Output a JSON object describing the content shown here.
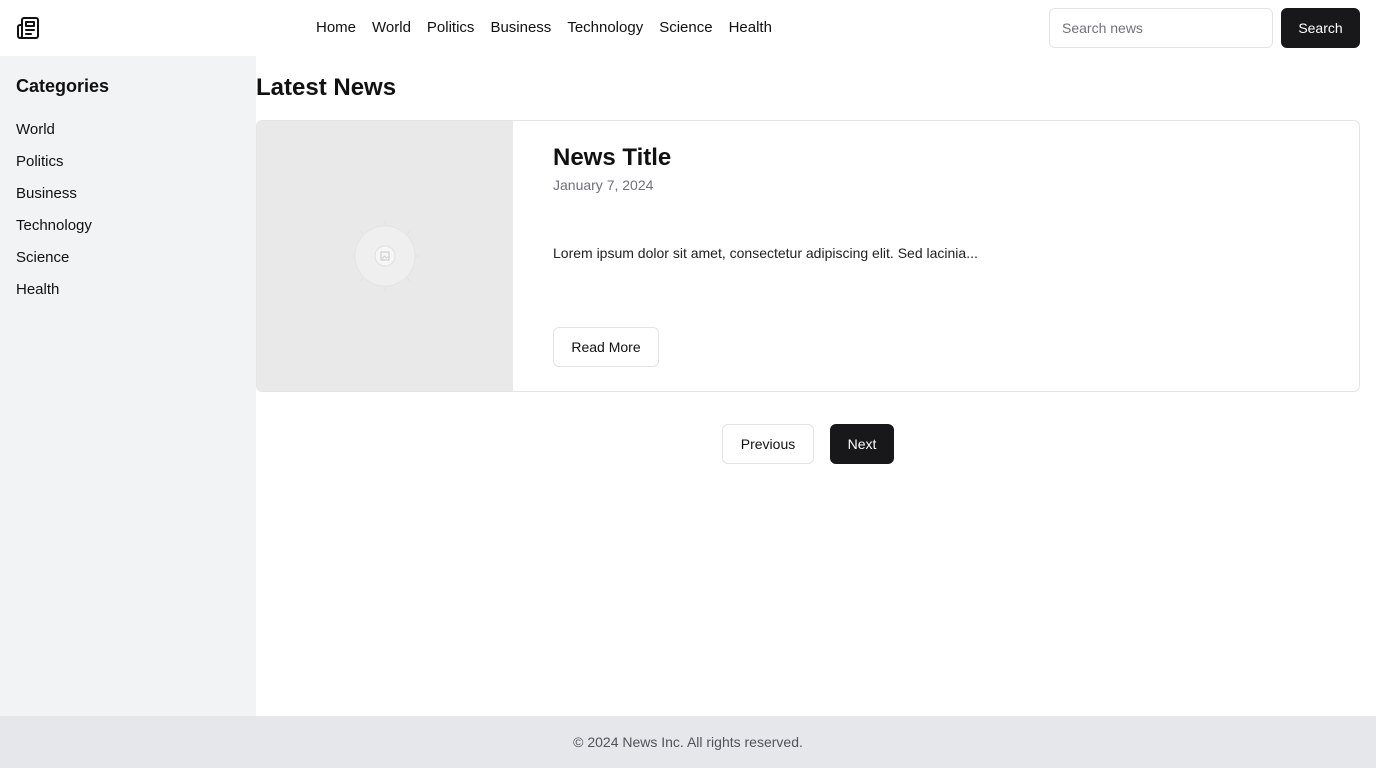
{
  "header": {
    "logo_icon": "newspaper-icon",
    "nav": [
      "Home",
      "World",
      "Politics",
      "Business",
      "Technology",
      "Science",
      "Health"
    ],
    "search": {
      "placeholder": "Search news",
      "value": "",
      "button_label": "Search"
    }
  },
  "sidebar": {
    "title": "Categories",
    "items": [
      "World",
      "Politics",
      "Business",
      "Technology",
      "Science",
      "Health"
    ]
  },
  "main": {
    "title": "Latest News",
    "article": {
      "image_icon": "image-placeholder-icon",
      "title": "News Title",
      "date": "January 7, 2024",
      "excerpt": "Lorem ipsum dolor sit amet, consectetur adipiscing elit. Sed lacinia...",
      "read_more_label": "Read More"
    },
    "pagination": {
      "previous_label": "Previous",
      "next_label": "Next"
    }
  },
  "footer": {
    "text": "© 2024 News Inc. All rights reserved."
  },
  "colors": {
    "primary": "#18181b",
    "sidebar_bg": "#f1f3f5",
    "footer_bg": "#e5e7eb",
    "border": "#e4e4e7",
    "muted_text": "#71717a"
  }
}
